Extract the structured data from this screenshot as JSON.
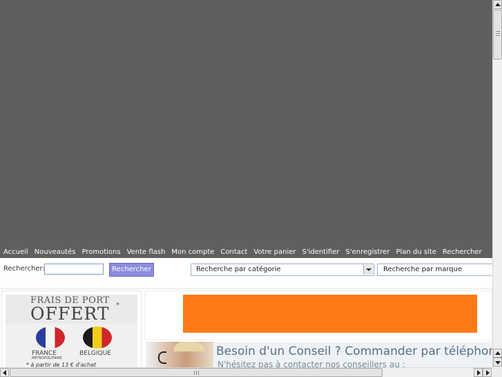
{
  "nav": {
    "items": [
      "Accueil",
      "Nouveautés",
      "Promotions",
      "Vente flash",
      "Mon compte",
      "Contact",
      "Votre panier",
      "S'identifier",
      "S'enregistrer",
      "Plan du site",
      "Rechercher"
    ]
  },
  "search": {
    "label": "Rechercher:",
    "input_value": "",
    "button_label": "Rechercher",
    "category_select": "Recherche par catégorie",
    "brand_select": "Recherche par marque"
  },
  "shipping_promo": {
    "line1": "FRAIS DE PORT",
    "line2": "OFFERT",
    "star": "*",
    "france_label": "FRANCE",
    "france_sub": "METROPOLITAINE",
    "belgium_label": "BELGIQUE",
    "note": "* à partir de 13 € d'achat"
  },
  "advice_banner": {
    "title": "Besoin d'un Conseil ? Commander par téléphone",
    "subtitle": "N'hésitez pas à contacter nos conseillers au :"
  },
  "colors": {
    "banner": "#5f5f5f",
    "nav_text": "#ffffff",
    "search_button": "#8c8ce0",
    "orange_banner": "#ff7916"
  }
}
